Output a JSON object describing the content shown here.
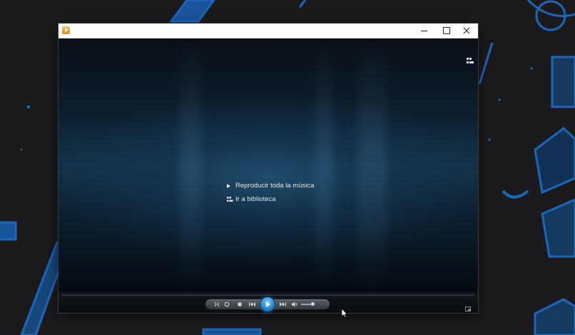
{
  "window": {
    "controls": {
      "minimize": "minimize",
      "maximize": "maximize",
      "close": "close"
    }
  },
  "main_menu": {
    "items": [
      {
        "label": "Reproducir toda la música",
        "icon": "play-icon"
      },
      {
        "label": "Ir a biblioteca",
        "icon": "library-icon"
      }
    ]
  },
  "player_controls": {
    "buttons": [
      "shuffle-icon",
      "repeat-icon",
      "stop-icon",
      "previous-icon",
      "play-icon",
      "next-icon",
      "volume-icon"
    ],
    "volume_level": 0.75
  },
  "icons": {
    "app": "media-player-icon",
    "view_switch": "switch-to-library-icon",
    "mini_mode": "switch-to-mini-mode-icon"
  },
  "colors": {
    "accent": "#2a86cc",
    "video_bg": "#13324a",
    "wallpaper": "#1b1b1d",
    "wallpaper_drawing": "#1e74d6"
  }
}
